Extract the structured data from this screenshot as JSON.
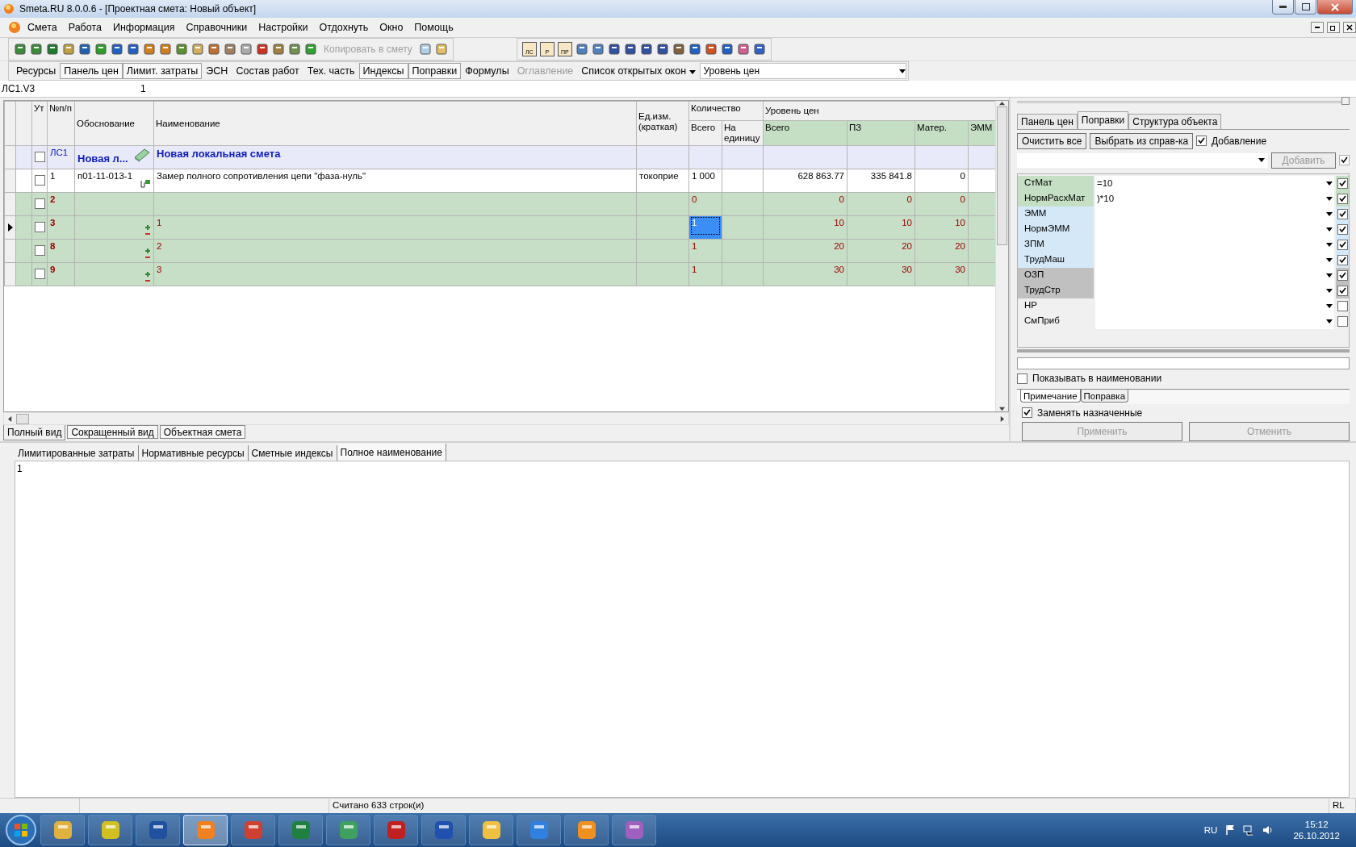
{
  "window": {
    "title": "Smeta.RU  8.0.0.6  - [Проектная смета: Новый объект]"
  },
  "menu": [
    "Смета",
    "Работа",
    "Информация",
    "Справочники",
    "Настройки",
    "Отдохнуть",
    "Окно",
    "Помощь"
  ],
  "toolbar": {
    "copy_label": "Копировать в смету",
    "copy_disabled": true,
    "letter_icons": [
      "ЛС",
      "Р",
      "ПР"
    ]
  },
  "view_bar": {
    "items": [
      {
        "label": "Ресурсы",
        "pressed": false,
        "disabled": false
      },
      {
        "label": "Панель цен",
        "pressed": true,
        "disabled": false
      },
      {
        "label": "Лимит. затраты",
        "pressed": true,
        "disabled": false
      },
      {
        "label": "ЭСН",
        "pressed": false,
        "disabled": false
      },
      {
        "label": "Состав работ",
        "pressed": false,
        "disabled": false
      },
      {
        "label": "Тех. часть",
        "pressed": false,
        "disabled": false
      },
      {
        "label": "Индексы",
        "pressed": true,
        "disabled": false
      },
      {
        "label": "Поправки",
        "pressed": true,
        "disabled": false
      },
      {
        "label": "Формулы",
        "pressed": false,
        "disabled": false
      },
      {
        "label": "Оглавление",
        "pressed": false,
        "disabled": true
      }
    ],
    "windows_menu": "Список открытых окон",
    "price_level": "Уровень цен"
  },
  "formula_bar": {
    "cell": "ЛС1.V3",
    "value": "1"
  },
  "grid": {
    "columns": {
      "ut": "Ут",
      "num": "№п/п",
      "basis": "Обоснование",
      "name": "Наименование",
      "unit": "Ед.изм. (краткая)",
      "qty_group": "Количество",
      "qty_total": "Всего",
      "qty_unit": "На единицу",
      "price_group": "Уровень цен",
      "price_total": "Всего",
      "pz": "ПЗ",
      "mat": "Матер.",
      "emm": "ЭММ"
    },
    "rows": [
      {
        "kind": "section",
        "num": "ЛС1",
        "basis": "Новая л...",
        "name": "Новая локальная смета",
        "unit": "",
        "qty_total": "",
        "qty_unit": "",
        "price_total": "",
        "pz": "",
        "mat": "",
        "emm": "",
        "checked": false,
        "selected": false
      },
      {
        "kind": "item",
        "num": "1",
        "basis": "п01-11-013-1",
        "name": "Замер полного сопротивления цепи \"фаза-нуль\"",
        "unit": "токоприе",
        "qty_total": "1 000",
        "qty_unit": "",
        "price_total": "628 863.77",
        "pz": "335 841.8",
        "mat": "0",
        "emm": "",
        "checked": false,
        "selected": false
      },
      {
        "kind": "resource",
        "num": "2",
        "basis": "",
        "name": "",
        "unit": "",
        "qty_total": "0",
        "qty_unit": "",
        "price_total": "0",
        "pz": "0",
        "mat": "0",
        "emm": "",
        "checked": false,
        "selected": false,
        "adjust": false
      },
      {
        "kind": "resource",
        "num": "3",
        "basis": "",
        "name": "1",
        "unit": "",
        "qty_total": "1",
        "qty_unit": "",
        "price_total": "10",
        "pz": "10",
        "mat": "10",
        "emm": "",
        "checked": false,
        "selected": true,
        "adjust": true
      },
      {
        "kind": "resource",
        "num": "8",
        "basis": "",
        "name": "2",
        "unit": "",
        "qty_total": "1",
        "qty_unit": "",
        "price_total": "20",
        "pz": "20",
        "mat": "20",
        "emm": "",
        "checked": false,
        "selected": false,
        "adjust": true
      },
      {
        "kind": "resource",
        "num": "9",
        "basis": "",
        "name": "3",
        "unit": "",
        "qty_total": "1",
        "qty_unit": "",
        "price_total": "30",
        "pz": "30",
        "mat": "30",
        "emm": "",
        "checked": false,
        "selected": false,
        "adjust": true
      }
    ]
  },
  "view_tabs": [
    {
      "label": "Полный вид",
      "selected": true
    },
    {
      "label": "Сокращенный вид",
      "selected": false
    },
    {
      "label": "Объектная смета",
      "selected": false
    }
  ],
  "side_panel": {
    "tabs": [
      {
        "label": "Панель цен",
        "selected": false
      },
      {
        "label": "Поправки",
        "selected": true
      },
      {
        "label": "Структура объекта",
        "selected": false
      }
    ],
    "clear_button": "Очистить все",
    "pick_button": "Выбрать из справ-ка",
    "append": {
      "label": "Добавление",
      "checked": true
    },
    "add_button": "Добавить",
    "add_checked": true,
    "corrections": [
      {
        "name": "СтМат",
        "value": "=10",
        "checked": true,
        "color": "#c4dfc4"
      },
      {
        "name": "НормРасхМат",
        "value": ")*10",
        "checked": true,
        "color": "#c4dfc4"
      },
      {
        "name": "ЭММ",
        "checked": true,
        "color": "#d5e8f8"
      },
      {
        "name": "НормЭММ",
        "checked": true,
        "color": "#d5e8f8"
      },
      {
        "name": "ЗПМ",
        "checked": true,
        "color": "#d5e8f8"
      },
      {
        "name": "ТрудМаш",
        "checked": true,
        "color": "#d5e8f8"
      },
      {
        "name": "ОЗП",
        "checked": true,
        "color": "#c0c0c0"
      },
      {
        "name": "ТрудСтр",
        "checked": true,
        "color": "#c0c0c0"
      },
      {
        "name": "НР",
        "checked": false,
        "color": "#f0f0f0"
      },
      {
        "name": "СмПриб",
        "checked": false,
        "color": "#f0f0f0"
      }
    ],
    "show_in_name": {
      "label": "Показывать в наименовании",
      "checked": false
    },
    "note_tabs": [
      {
        "label": "Примечание",
        "selected": true
      },
      {
        "label": "Поправка",
        "selected": false
      }
    ],
    "replace": {
      "label": "Заменять назначенные",
      "checked": true
    },
    "apply_button": "Применить",
    "cancel_button": "Отменить",
    "buttons_disabled": true
  },
  "detail_tabs": [
    {
      "label": "Лимитированные затраты",
      "selected": false
    },
    {
      "label": "Нормативные ресурсы",
      "selected": false
    },
    {
      "label": "Сметные индексы",
      "selected": false
    },
    {
      "label": "Полное наименование",
      "selected": true
    }
  ],
  "detail_text": "1",
  "status_bar": {
    "message": "Считано 633 строк(и)",
    "layout": "RL"
  },
  "taskbar": {
    "language": "RU",
    "time": "15:12",
    "date": "26.10.2012"
  }
}
